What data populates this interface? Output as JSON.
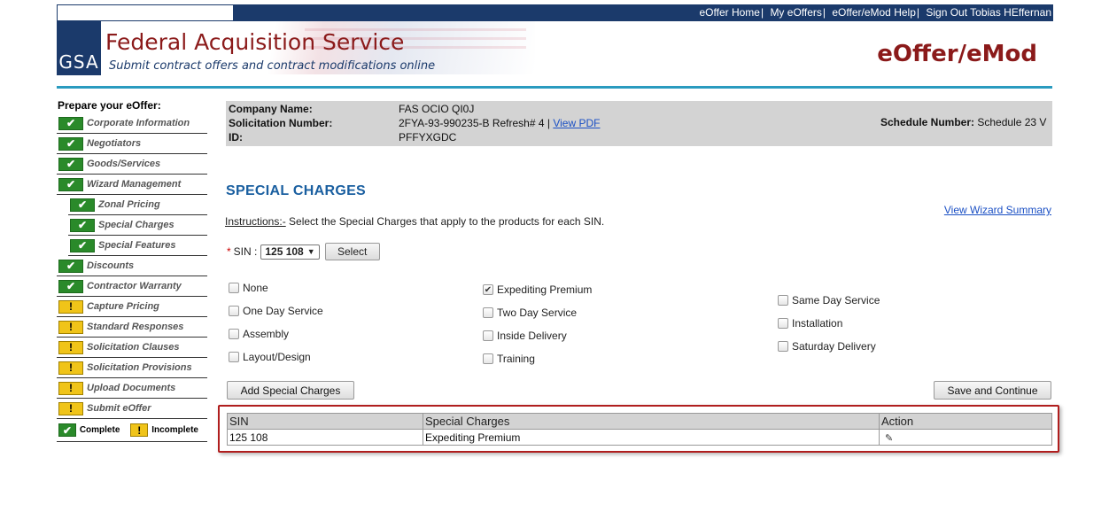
{
  "topnav": {
    "items": [
      "eOffer Home",
      "My eOffers",
      "eOffer/eMod Help",
      "Sign Out Tobias HEffernan"
    ]
  },
  "header": {
    "logo_text": "GSA",
    "title": "Federal Acquisition Service",
    "subtitle": "Submit contract offers and contract modifications online",
    "brand": "eOffer/eMod"
  },
  "sidebar": {
    "title": "Prepare your eOffer:",
    "items": [
      {
        "label": "Corporate Information",
        "status": "complete",
        "sub": false
      },
      {
        "label": "Negotiators",
        "status": "complete",
        "sub": false
      },
      {
        "label": "Goods/Services",
        "status": "complete",
        "sub": false
      },
      {
        "label": "Wizard Management",
        "status": "complete",
        "sub": false
      },
      {
        "label": "Zonal Pricing",
        "status": "complete",
        "sub": true
      },
      {
        "label": "Special Charges",
        "status": "complete",
        "sub": true
      },
      {
        "label": "Special Features",
        "status": "complete",
        "sub": true
      },
      {
        "label": "Discounts",
        "status": "complete",
        "sub": false
      },
      {
        "label": "Contractor Warranty",
        "status": "complete",
        "sub": false
      },
      {
        "label": "Capture Pricing",
        "status": "incomplete",
        "sub": false
      },
      {
        "label": "Standard Responses",
        "status": "incomplete",
        "sub": false
      },
      {
        "label": "Solicitation Clauses",
        "status": "incomplete",
        "sub": false
      },
      {
        "label": "Solicitation Provisions",
        "status": "incomplete",
        "sub": false
      },
      {
        "label": "Upload Documents",
        "status": "incomplete",
        "sub": false
      },
      {
        "label": "Submit eOffer",
        "status": "incomplete",
        "sub": false
      }
    ],
    "legend_complete": "Complete",
    "legend_incomplete": "Incomplete"
  },
  "info": {
    "company_label": "Company Name:",
    "company_value": "FAS OCIO QI0J",
    "solicitation_label": "Solicitation Number:",
    "solicitation_value": "2FYA-93-990235-B Refresh# 4 |",
    "view_pdf": "View PDF",
    "id_label": "ID:",
    "id_value": "PFFYXGDC",
    "schedule_label": "Schedule Number:",
    "schedule_value": "Schedule 23 V"
  },
  "main": {
    "section_title": "SPECIAL CHARGES",
    "instructions_label": "Instructions:-",
    "instructions_text": " Select the Special Charges that apply to the products for each SIN.",
    "wizard_link": "View Wizard Summary",
    "sin_label": "SIN :",
    "sin_value": "125 108",
    "select_button": "Select",
    "add_button": "Add Special Charges",
    "save_button": "Save and Continue"
  },
  "charges": {
    "col1": [
      {
        "label": "None",
        "checked": false
      },
      {
        "label": "One Day Service",
        "checked": false
      },
      {
        "label": "Assembly",
        "checked": false
      },
      {
        "label": "Layout/Design",
        "checked": false
      }
    ],
    "col2": [
      {
        "label": "Expediting Premium",
        "checked": true
      },
      {
        "label": "Two Day Service",
        "checked": false
      },
      {
        "label": "Inside Delivery",
        "checked": false
      },
      {
        "label": "Training",
        "checked": false
      }
    ],
    "col3": [
      {
        "label": "Same Day Service",
        "checked": false
      },
      {
        "label": "Installation",
        "checked": false
      },
      {
        "label": "Saturday Delivery",
        "checked": false
      }
    ]
  },
  "table": {
    "headers": [
      "SIN",
      "Special Charges",
      "Action"
    ],
    "rows": [
      {
        "sin": "125 108",
        "charge": "Expediting Premium"
      }
    ]
  },
  "icons": {
    "check": "check-icon",
    "warning": "warning-icon",
    "edit": "pencil-icon"
  },
  "colors": {
    "nav_bg": "#1b3a6b",
    "brand_red": "#8b1a1a",
    "accent_blue": "#2a9bbf",
    "complete_green": "#2a8a2a",
    "incomplete_yellow": "#f0c419",
    "highlight_border": "#b01e1e"
  }
}
